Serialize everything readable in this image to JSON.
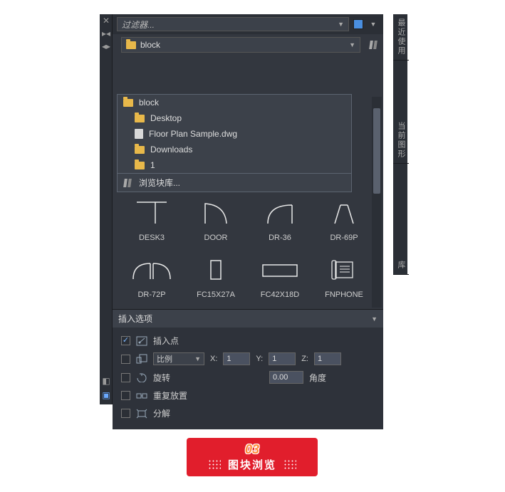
{
  "titlebar": {
    "filter_placeholder": "过滤器...",
    "color_swatch": "#4a8fe0"
  },
  "path_combo": {
    "selected": "block"
  },
  "dropdown": {
    "items": [
      {
        "icon": "folder",
        "label": "block",
        "indent": false
      },
      {
        "icon": "folder",
        "label": "Desktop",
        "indent": true
      },
      {
        "icon": "file",
        "label": "Floor Plan Sample.dwg",
        "indent": true
      },
      {
        "icon": "folder",
        "label": "Downloads",
        "indent": true
      },
      {
        "icon": "folder",
        "label": "1",
        "indent": true
      }
    ],
    "browse_label": "浏览块库..."
  },
  "blocks": [
    {
      "name": "DESK3"
    },
    {
      "name": "DOOR"
    },
    {
      "name": "DR-36"
    },
    {
      "name": "DR-69P"
    },
    {
      "name": "DR-72P"
    },
    {
      "name": "FC15X27A"
    },
    {
      "name": "FC42X18D"
    },
    {
      "name": "FNPHONE"
    }
  ],
  "options": {
    "header": "插入选项",
    "insert_point": {
      "label": "插入点",
      "checked": true
    },
    "scale": {
      "label": "比例",
      "checked": false,
      "x_label": "X:",
      "y_label": "Y:",
      "z_label": "Z:",
      "x": "1",
      "y": "1",
      "z": "1"
    },
    "rotate": {
      "label": "旋转",
      "checked": false,
      "angle_label": "角度",
      "angle": "0.00"
    },
    "repeat": {
      "label": "重复放置",
      "checked": false
    },
    "explode": {
      "label": "分解",
      "checked": false
    }
  },
  "banner": {
    "number": "03",
    "title": "图块浏览"
  },
  "right_tabs": [
    "最近使用",
    "当前图形",
    "库"
  ]
}
